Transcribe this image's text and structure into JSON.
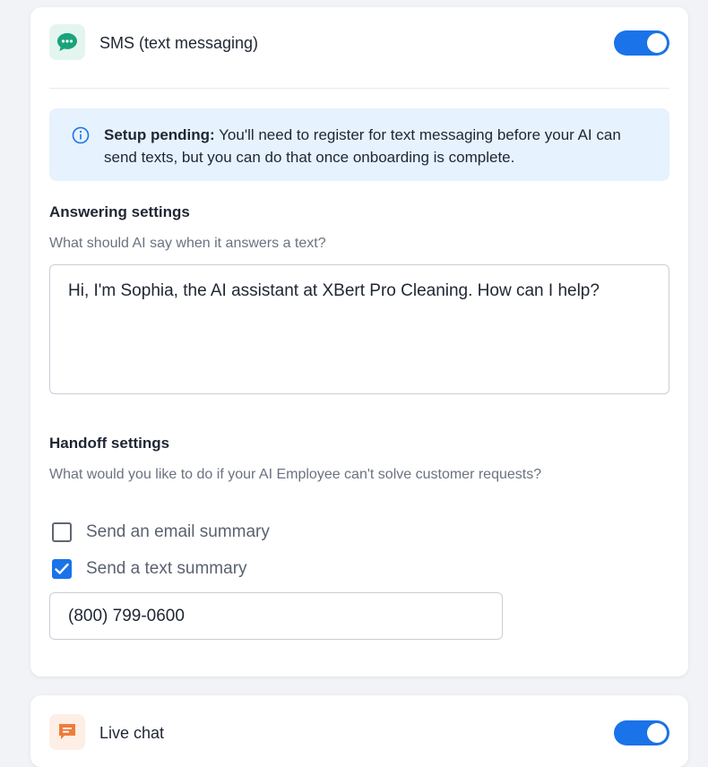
{
  "sms": {
    "title": "SMS (text messaging)",
    "enabled": true,
    "icon": "speech-bubble-dots-icon",
    "icon_color": "#1aa37a",
    "notice": {
      "bold": "Setup pending:",
      "text": " You'll need to register for text messaging before your AI can send texts, but you can do that once onboarding is complete."
    },
    "answering": {
      "title": "Answering settings",
      "subtitle": "What should AI say when it answers a text?",
      "greeting": "Hi, I'm Sophia, the AI assistant at XBert Pro Cleaning. How can I help?"
    },
    "handoff": {
      "title": "Handoff settings",
      "subtitle": "What would you like to do if your AI Employee can't solve customer requests?",
      "options": [
        {
          "label": "Send an email summary",
          "checked": false
        },
        {
          "label": "Send a text summary",
          "checked": true
        }
      ],
      "phone": "(800) 799-0600"
    }
  },
  "live_chat": {
    "title": "Live chat",
    "enabled": true,
    "icon": "chat-lines-icon",
    "icon_color": "#f07c3c"
  },
  "colors": {
    "accent": "#1a73e8",
    "notice_bg": "#e6f2fd"
  }
}
